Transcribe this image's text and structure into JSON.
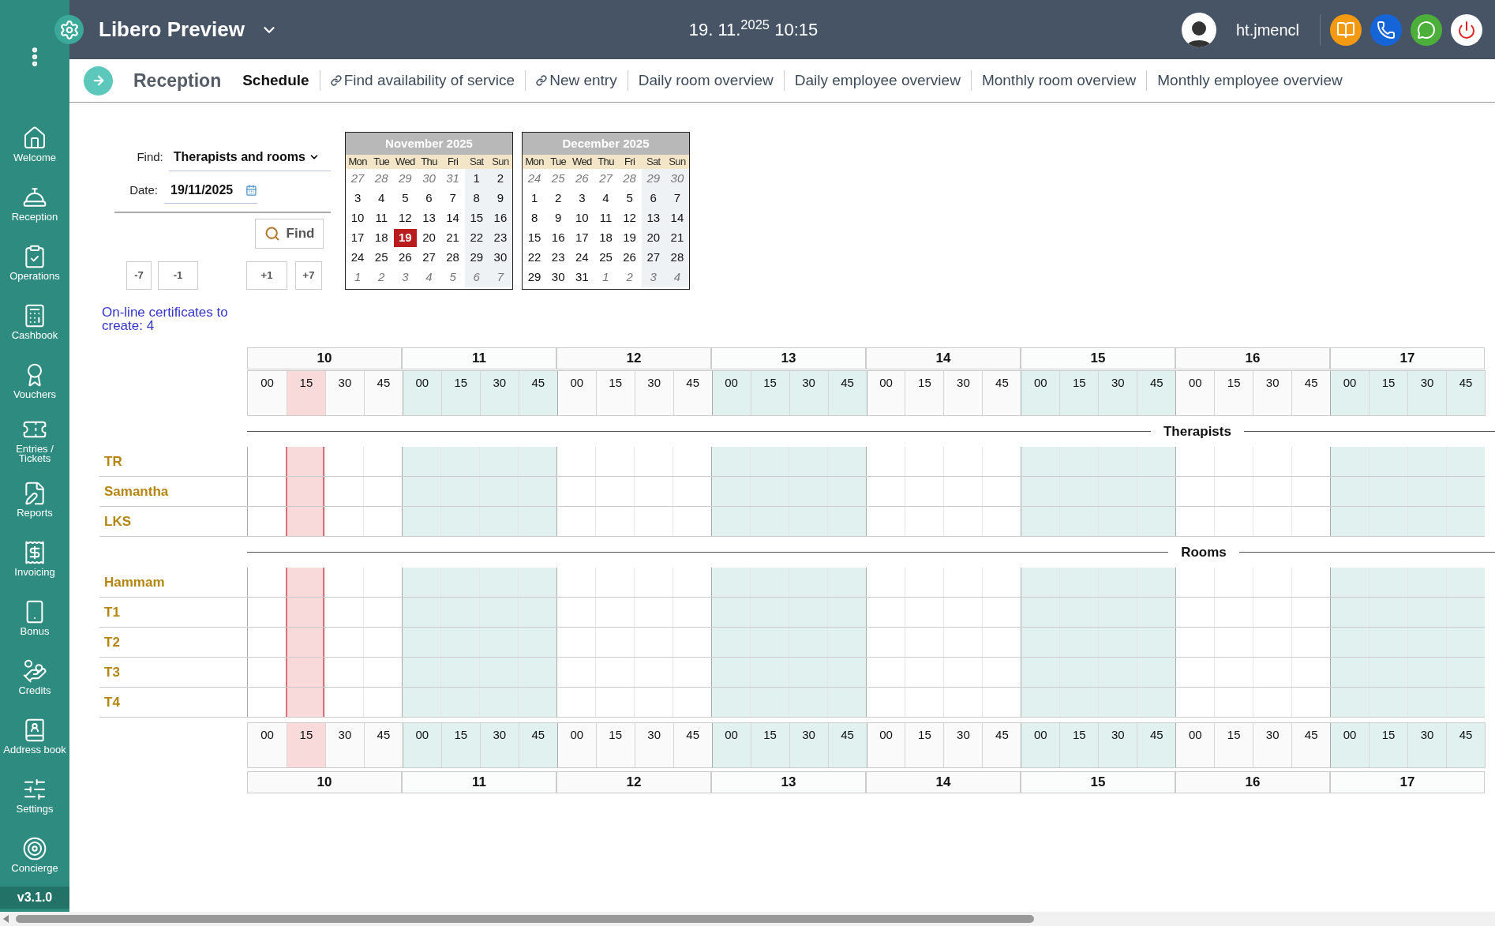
{
  "app": {
    "title": "Libero Preview",
    "datetime": "19. 11.$^{2025}$ 10:15",
    "user": "ht.jmencl"
  },
  "sidebar": {
    "items": [
      {
        "label": "Welcome"
      },
      {
        "label": "Reception"
      },
      {
        "label": "Operations"
      },
      {
        "label": "Cashbook"
      },
      {
        "label": "Vouchers"
      },
      {
        "label": "Entries / Tickets"
      },
      {
        "label": "Reports"
      },
      {
        "label": "Invoicing"
      },
      {
        "label": "Bonus"
      },
      {
        "label": "Credits"
      },
      {
        "label": "Address book"
      },
      {
        "label": "Settings"
      },
      {
        "label": "Concierge"
      }
    ],
    "version": "v3.1.0"
  },
  "subnav": {
    "title": "Reception",
    "tabs": [
      {
        "label": "Schedule",
        "selected": true,
        "kind": "page"
      },
      {
        "label": "Find availability of service",
        "selected": false,
        "kind": "link"
      },
      {
        "label": "New entry",
        "selected": false,
        "kind": "link"
      },
      {
        "label": "Daily room overview",
        "selected": false,
        "kind": "page"
      },
      {
        "label": "Daily employee overview",
        "selected": false,
        "kind": "page"
      },
      {
        "label": "Monthly room overview",
        "selected": false,
        "kind": "page"
      },
      {
        "label": "Monthly employee overview",
        "selected": false,
        "kind": "page"
      }
    ]
  },
  "search_form": {
    "find_label": "Find:",
    "find_value": "Therapists and rooms",
    "date_label": "Date:",
    "date_value": "19/11/2025",
    "find_button": "Find",
    "step_buttons": [
      "-7",
      "-1",
      "+1",
      "+7"
    ]
  },
  "certificates_link": "On-line certificates to create: 4",
  "calendars": [
    {
      "title": "November 2025",
      "weekdays": [
        {
          "label": "Mon",
          "weekend": false
        },
        {
          "label": "Tue",
          "weekend": false
        },
        {
          "label": "Wed",
          "weekend": false
        },
        {
          "label": "Thu",
          "weekend": false
        },
        {
          "label": "Fri",
          "weekend": false
        },
        {
          "label": "Sat",
          "weekend": true
        },
        {
          "label": "Sun",
          "weekend": true
        }
      ],
      "weeks": [
        {
          "days": [
            {
              "day": "27",
              "outside": true,
              "selected": false
            },
            {
              "day": "28",
              "outside": true,
              "selected": false
            },
            {
              "day": "29",
              "outside": true,
              "selected": false
            },
            {
              "day": "30",
              "outside": true,
              "selected": false
            },
            {
              "day": "31",
              "outside": true,
              "selected": false
            },
            {
              "day": "1",
              "outside": false,
              "selected": false
            },
            {
              "day": "2",
              "outside": false,
              "selected": false
            }
          ]
        },
        {
          "days": [
            {
              "day": "3",
              "outside": false,
              "selected": false
            },
            {
              "day": "4",
              "outside": false,
              "selected": false
            },
            {
              "day": "5",
              "outside": false,
              "selected": false
            },
            {
              "day": "6",
              "outside": false,
              "selected": false
            },
            {
              "day": "7",
              "outside": false,
              "selected": false
            },
            {
              "day": "8",
              "outside": false,
              "selected": false
            },
            {
              "day": "9",
              "outside": false,
              "selected": false
            }
          ]
        },
        {
          "days": [
            {
              "day": "10",
              "outside": false,
              "selected": false
            },
            {
              "day": "11",
              "outside": false,
              "selected": false
            },
            {
              "day": "12",
              "outside": false,
              "selected": false
            },
            {
              "day": "13",
              "outside": false,
              "selected": false
            },
            {
              "day": "14",
              "outside": false,
              "selected": false
            },
            {
              "day": "15",
              "outside": false,
              "selected": false
            },
            {
              "day": "16",
              "outside": false,
              "selected": false
            }
          ]
        },
        {
          "days": [
            {
              "day": "17",
              "outside": false,
              "selected": false
            },
            {
              "day": "18",
              "outside": false,
              "selected": false
            },
            {
              "day": "19",
              "outside": false,
              "selected": true
            },
            {
              "day": "20",
              "outside": false,
              "selected": false
            },
            {
              "day": "21",
              "outside": false,
              "selected": false
            },
            {
              "day": "22",
              "outside": false,
              "selected": false
            },
            {
              "day": "23",
              "outside": false,
              "selected": false
            }
          ]
        },
        {
          "days": [
            {
              "day": "24",
              "outside": false,
              "selected": false
            },
            {
              "day": "25",
              "outside": false,
              "selected": false
            },
            {
              "day": "26",
              "outside": false,
              "selected": false
            },
            {
              "day": "27",
              "outside": false,
              "selected": false
            },
            {
              "day": "28",
              "outside": false,
              "selected": false
            },
            {
              "day": "29",
              "outside": false,
              "selected": false
            },
            {
              "day": "30",
              "outside": false,
              "selected": false
            }
          ]
        },
        {
          "days": [
            {
              "day": "1",
              "outside": true,
              "selected": false
            },
            {
              "day": "2",
              "outside": true,
              "selected": false
            },
            {
              "day": "3",
              "outside": true,
              "selected": false
            },
            {
              "day": "4",
              "outside": true,
              "selected": false
            },
            {
              "day": "5",
              "outside": true,
              "selected": false
            },
            {
              "day": "6",
              "outside": true,
              "selected": false
            },
            {
              "day": "7",
              "outside": true,
              "selected": false
            }
          ]
        }
      ]
    },
    {
      "title": "December 2025",
      "weekdays": [
        {
          "label": "Mon",
          "weekend": false
        },
        {
          "label": "Tue",
          "weekend": false
        },
        {
          "label": "Wed",
          "weekend": false
        },
        {
          "label": "Thu",
          "weekend": false
        },
        {
          "label": "Fri",
          "weekend": false
        },
        {
          "label": "Sat",
          "weekend": true
        },
        {
          "label": "Sun",
          "weekend": true
        }
      ],
      "weeks": [
        {
          "days": [
            {
              "day": "24",
              "outside": true,
              "selected": false
            },
            {
              "day": "25",
              "outside": true,
              "selected": false
            },
            {
              "day": "26",
              "outside": true,
              "selected": false
            },
            {
              "day": "27",
              "outside": true,
              "selected": false
            },
            {
              "day": "28",
              "outside": true,
              "selected": false
            },
            {
              "day": "29",
              "outside": true,
              "selected": false
            },
            {
              "day": "30",
              "outside": true,
              "selected": false
            }
          ]
        },
        {
          "days": [
            {
              "day": "1",
              "outside": false,
              "selected": false
            },
            {
              "day": "2",
              "outside": false,
              "selected": false
            },
            {
              "day": "3",
              "outside": false,
              "selected": false
            },
            {
              "day": "4",
              "outside": false,
              "selected": false
            },
            {
              "day": "5",
              "outside": false,
              "selected": false
            },
            {
              "day": "6",
              "outside": false,
              "selected": false
            },
            {
              "day": "7",
              "outside": false,
              "selected": false
            }
          ]
        },
        {
          "days": [
            {
              "day": "8",
              "outside": false,
              "selected": false
            },
            {
              "day": "9",
              "outside": false,
              "selected": false
            },
            {
              "day": "10",
              "outside": false,
              "selected": false
            },
            {
              "day": "11",
              "outside": false,
              "selected": false
            },
            {
              "day": "12",
              "outside": false,
              "selected": false
            },
            {
              "day": "13",
              "outside": false,
              "selected": false
            },
            {
              "day": "14",
              "outside": false,
              "selected": false
            }
          ]
        },
        {
          "days": [
            {
              "day": "15",
              "outside": false,
              "selected": false
            },
            {
              "day": "16",
              "outside": false,
              "selected": false
            },
            {
              "day": "17",
              "outside": false,
              "selected": false
            },
            {
              "day": "18",
              "outside": false,
              "selected": false
            },
            {
              "day": "19",
              "outside": false,
              "selected": false
            },
            {
              "day": "20",
              "outside": false,
              "selected": false
            },
            {
              "day": "21",
              "outside": false,
              "selected": false
            }
          ]
        },
        {
          "days": [
            {
              "day": "22",
              "outside": false,
              "selected": false
            },
            {
              "day": "23",
              "outside": false,
              "selected": false
            },
            {
              "day": "24",
              "outside": false,
              "selected": false
            },
            {
              "day": "25",
              "outside": false,
              "selected": false
            },
            {
              "day": "26",
              "outside": false,
              "selected": false
            },
            {
              "day": "27",
              "outside": false,
              "selected": false
            },
            {
              "day": "28",
              "outside": false,
              "selected": false
            }
          ]
        },
        {
          "days": [
            {
              "day": "29",
              "outside": false,
              "selected": false
            },
            {
              "day": "30",
              "outside": false,
              "selected": false
            },
            {
              "day": "31",
              "outside": false,
              "selected": false
            },
            {
              "day": "1",
              "outside": true,
              "selected": false
            },
            {
              "day": "2",
              "outside": true,
              "selected": false
            },
            {
              "day": "3",
              "outside": true,
              "selected": false
            },
            {
              "day": "4",
              "outside": true,
              "selected": false
            }
          ]
        }
      ]
    }
  ],
  "time_header": {
    "hours": [
      {
        "label": "10",
        "shaded": false
      },
      {
        "label": "11",
        "shaded": true
      },
      {
        "label": "12",
        "shaded": false
      },
      {
        "label": "13",
        "shaded": true
      },
      {
        "label": "14",
        "shaded": false
      },
      {
        "label": "15",
        "shaded": true
      },
      {
        "label": "16",
        "shaded": false
      },
      {
        "label": "17",
        "shaded": true
      }
    ],
    "slots": [
      {
        "label": "00",
        "current": false
      },
      {
        "label": "15",
        "current": true
      },
      {
        "label": "30",
        "current": false
      },
      {
        "label": "45",
        "current": false
      },
      {
        "label": "00",
        "current": false
      },
      {
        "label": "15",
        "current": false
      },
      {
        "label": "30",
        "current": false
      },
      {
        "label": "45",
        "current": false
      },
      {
        "label": "00",
        "current": false
      },
      {
        "label": "15",
        "current": false
      },
      {
        "label": "30",
        "current": false
      },
      {
        "label": "45",
        "current": false
      },
      {
        "label": "00",
        "current": false
      },
      {
        "label": "15",
        "current": false
      },
      {
        "label": "30",
        "current": false
      },
      {
        "label": "45",
        "current": false
      },
      {
        "label": "00",
        "current": false
      },
      {
        "label": "15",
        "current": false
      },
      {
        "label": "30",
        "current": false
      },
      {
        "label": "45",
        "current": false
      },
      {
        "label": "00",
        "current": false
      },
      {
        "label": "15",
        "current": false
      },
      {
        "label": "30",
        "current": false
      },
      {
        "label": "45",
        "current": false
      },
      {
        "label": "00",
        "current": false
      },
      {
        "label": "15",
        "current": false
      },
      {
        "label": "30",
        "current": false
      },
      {
        "label": "45",
        "current": false
      },
      {
        "label": "00",
        "current": false
      },
      {
        "label": "15",
        "current": false
      },
      {
        "label": "30",
        "current": false
      },
      {
        "label": "45",
        "current": false
      }
    ]
  },
  "sections": [
    {
      "title": "Therapists",
      "rows": [
        {
          "name": "TR"
        },
        {
          "name": "Samantha"
        },
        {
          "name": "LKS"
        }
      ]
    },
    {
      "title": "Rooms",
      "rows": [
        {
          "name": "Hammam"
        },
        {
          "name": "T1"
        },
        {
          "name": "T2"
        },
        {
          "name": "T3"
        },
        {
          "name": "T4"
        }
      ]
    }
  ],
  "time_footer": {
    "hours": [
      {
        "label": "10",
        "shaded": false
      },
      {
        "label": "11",
        "shaded": true
      },
      {
        "label": "12",
        "shaded": false
      },
      {
        "label": "13",
        "shaded": true
      },
      {
        "label": "14",
        "shaded": false
      },
      {
        "label": "15",
        "shaded": true
      },
      {
        "label": "16",
        "shaded": false
      },
      {
        "label": "17",
        "shaded": true
      }
    ],
    "slots": [
      {
        "label": "00",
        "current": false
      },
      {
        "label": "15",
        "current": true
      },
      {
        "label": "30",
        "current": false
      },
      {
        "label": "45",
        "current": false
      },
      {
        "label": "00",
        "current": false
      },
      {
        "label": "15",
        "current": false
      },
      {
        "label": "30",
        "current": false
      },
      {
        "label": "45",
        "current": false
      },
      {
        "label": "00",
        "current": false
      },
      {
        "label": "15",
        "current": false
      },
      {
        "label": "30",
        "current": false
      },
      {
        "label": "45",
        "current": false
      },
      {
        "label": "00",
        "current": false
      },
      {
        "label": "15",
        "current": false
      },
      {
        "label": "30",
        "current": false
      },
      {
        "label": "45",
        "current": false
      },
      {
        "label": "00",
        "current": false
      },
      {
        "label": "15",
        "current": false
      },
      {
        "label": "30",
        "current": false
      },
      {
        "label": "45",
        "current": false
      },
      {
        "label": "00",
        "current": false
      },
      {
        "label": "15",
        "current": false
      },
      {
        "label": "30",
        "current": false
      },
      {
        "label": "45",
        "current": false
      },
      {
        "label": "00",
        "current": false
      },
      {
        "label": "15",
        "current": false
      },
      {
        "label": "30",
        "current": false
      },
      {
        "label": "45",
        "current": false
      },
      {
        "label": "00",
        "current": false
      },
      {
        "label": "15",
        "current": false
      },
      {
        "label": "30",
        "current": false
      },
      {
        "label": "45",
        "current": false
      }
    ]
  }
}
